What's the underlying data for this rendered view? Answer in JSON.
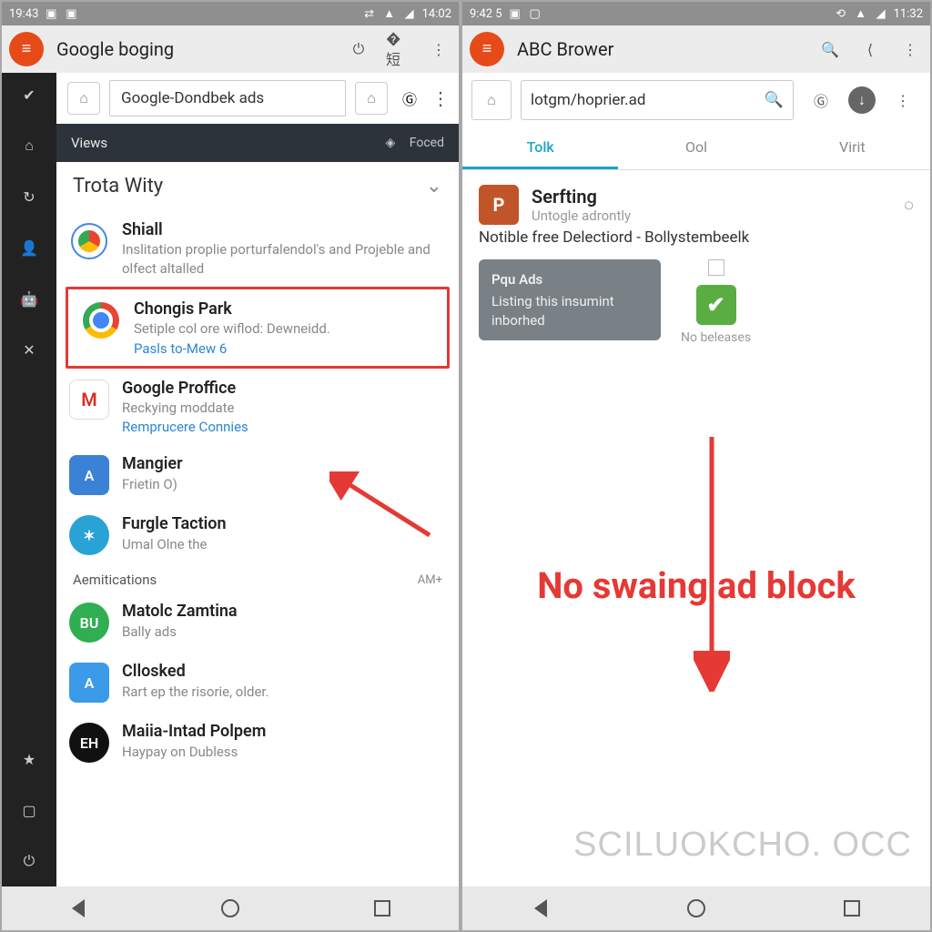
{
  "left": {
    "status": {
      "time_left": "19:43",
      "time_right": "14:02"
    },
    "header": {
      "title": "Google boging"
    },
    "urlbar": {
      "text": "Google-Dondbek ads"
    },
    "strip": {
      "left": "Views",
      "right": "Foced"
    },
    "section_title": "Trota Wity",
    "items": [
      {
        "title": "Shiall",
        "sub": "Inslitation proplie porturfalendol's and Projeble and olfect altalled",
        "link": "",
        "icon": "chrome-alt"
      },
      {
        "title": "Chongis Park",
        "sub": "Setiple col ore wiflod: Dewneidd.",
        "link": "Pasls to-Mew 6",
        "icon": "chrome"
      },
      {
        "title": "Google Proffice",
        "sub": "Reckying moddate",
        "link": "Remprucere Connies",
        "icon": "gmail"
      },
      {
        "title": "Mangier",
        "sub": "Frietin O)",
        "link": "",
        "icon": "appstore"
      },
      {
        "title": "Furgle Taction",
        "sub": "Umal Olne the",
        "link": "",
        "icon": "twitter"
      }
    ],
    "sub_section": {
      "title": "Aemitications",
      "tag": "AM+"
    },
    "items2": [
      {
        "title": "Matolc Zamtina",
        "sub": "Bally ads",
        "icon": "BU",
        "color": "#2fae52"
      },
      {
        "title": "Cllosked",
        "sub": "Rart ep the risorie, older.",
        "icon": "appstore",
        "color": "#3b9be8"
      },
      {
        "title": "Maiia-Intad Polpem",
        "sub": "Haypay on Dubless",
        "icon": "EH",
        "color": "#111"
      }
    ]
  },
  "right": {
    "status": {
      "time_left": "9:42 5",
      "time_right": "11:32"
    },
    "header": {
      "title": "ABC Brower"
    },
    "urlbar": {
      "text": "lotgm/hoprier.ad"
    },
    "tabs": [
      "Tolk",
      "Ool",
      "Virit"
    ],
    "result": {
      "title": "Serfting",
      "sub": "Untogle adrontly"
    },
    "notice": "Notible free Delectiord - Bollystembeelk",
    "gray_card": {
      "title": "Pqu Ads",
      "body": "Listing this insumint inborhed"
    },
    "check_caption": "No beleases",
    "big_text": "No swaing ad block",
    "watermark": "SCILUOKCHO. OCC"
  }
}
